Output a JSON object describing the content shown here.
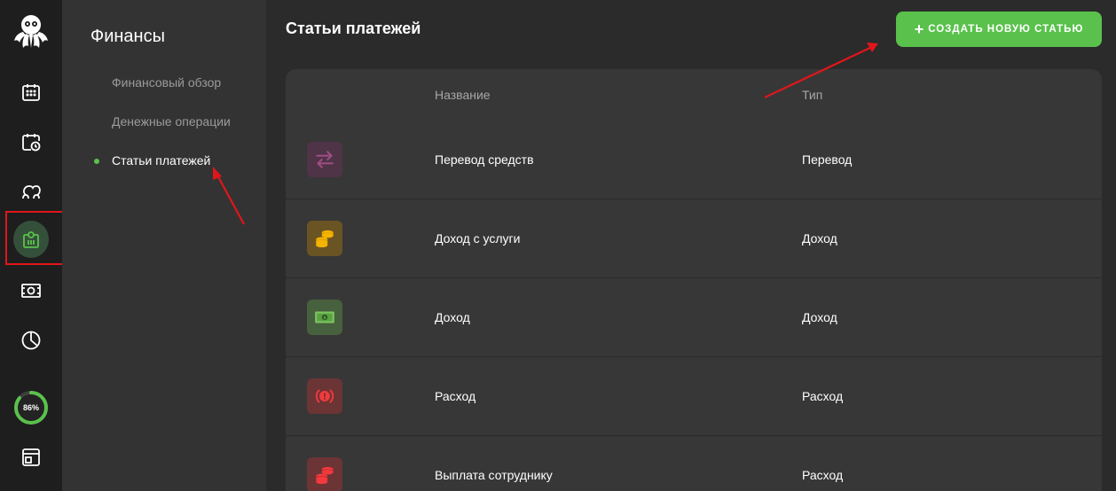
{
  "sidebar": {
    "progress_label": "86%",
    "progress_value": 0.86,
    "icons": [
      "octopus-logo",
      "calendar-icon",
      "calendar-clock-icon",
      "clients-icon",
      "finance-icon",
      "cash-icon",
      "pie-chart-icon",
      "window-icon"
    ]
  },
  "subnav": {
    "title": "Финансы",
    "items": [
      {
        "label": "Финансовый обзор"
      },
      {
        "label": "Денежные операции"
      },
      {
        "label": "Статьи платежей"
      }
    ]
  },
  "main": {
    "title": "Статьи платежей",
    "create_button": "СОЗДАТЬ НОВУЮ СТАТЬЮ",
    "table": {
      "headers": {
        "name": "Название",
        "type": "Тип"
      },
      "rows": [
        {
          "name": "Перевод средств",
          "type": "Перевод",
          "icon": "transfer-icon"
        },
        {
          "name": "Доход с услуги",
          "type": "Доход",
          "icon": "coins-icon"
        },
        {
          "name": "Доход",
          "type": "Доход",
          "icon": "banknote-icon"
        },
        {
          "name": "Расход",
          "type": "Расход",
          "icon": "alert-icon"
        },
        {
          "name": "Выплата сотруднику",
          "type": "Расход",
          "icon": "coins-red-icon"
        }
      ]
    }
  },
  "colors": {
    "accent": "#5ac14c",
    "annotation": "#e0161b",
    "rail_bg": "#1e1e1e",
    "subnav_bg": "#333333",
    "panel_bg": "#373737"
  }
}
